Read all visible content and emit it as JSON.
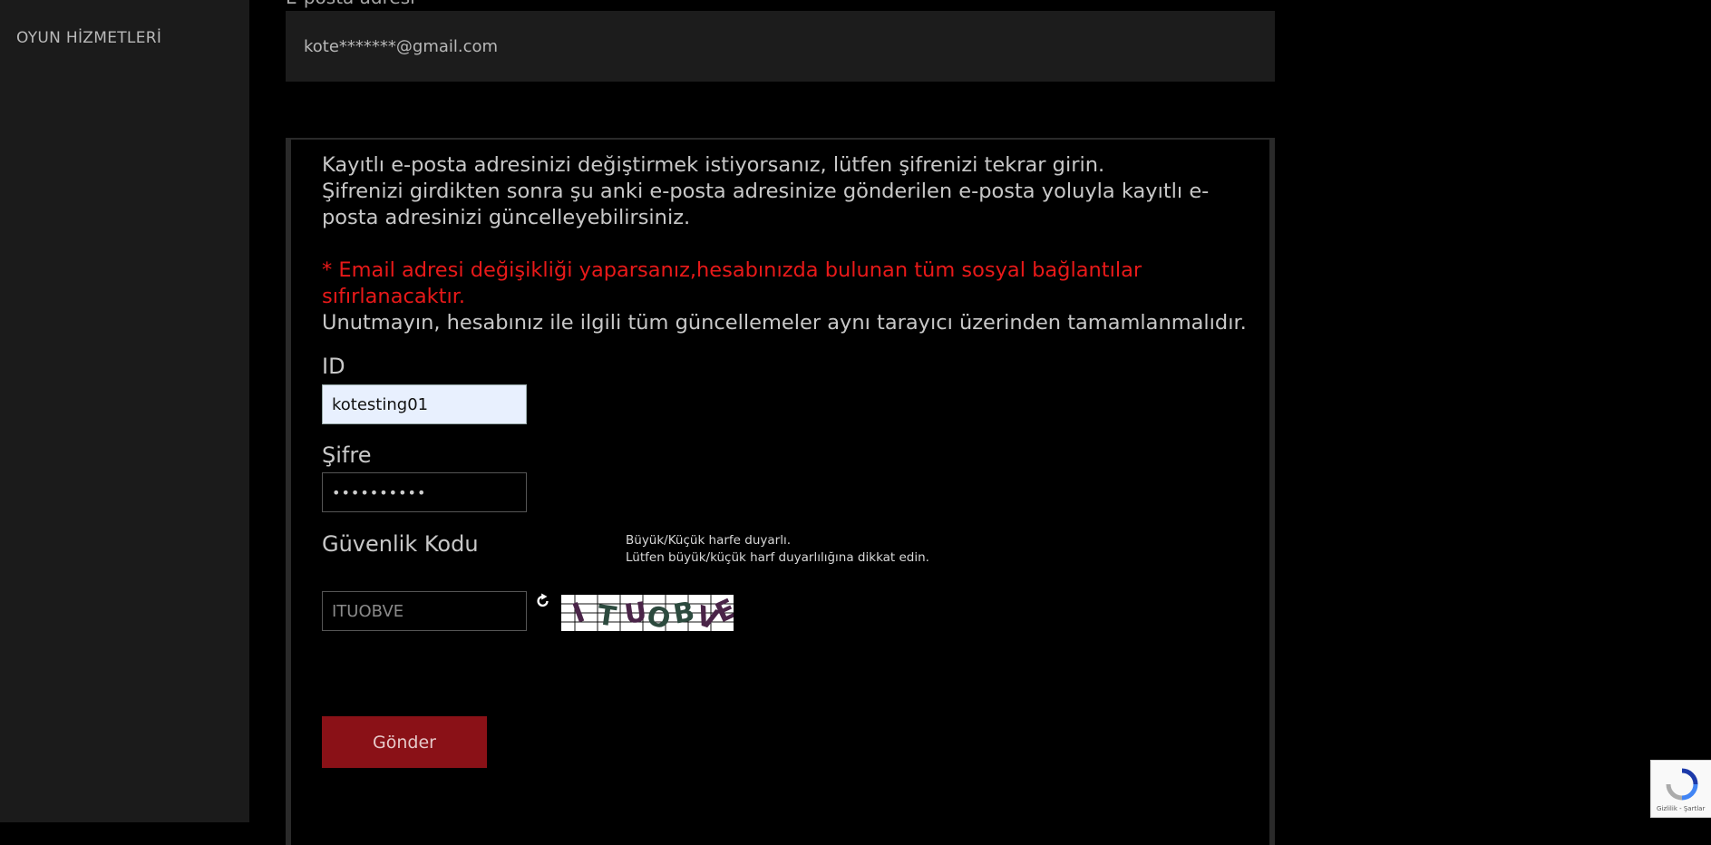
{
  "sidebar": {
    "items": [
      {
        "label": "OYUN HİZMETLERİ"
      }
    ]
  },
  "email": {
    "label": "E-posta adresi",
    "value": "kote*******@gmail.com"
  },
  "notice": {
    "line1": "Kayıtlı e-posta adresinizi değiştirmek istiyorsanız, lütfen şifrenizi tekrar girin.",
    "line2": "Şifrenizi girdikten sonra şu anki e-posta adresinize gönderilen e-posta yoluyla kayıtlı e-posta adresinizi güncelleyebilirsiniz.",
    "warning": "* Email adresi değişikliği yaparsanız,hesabınızda bulunan tüm sosyal bağlantılar sıfırlanacaktır.",
    "line3": "Unutmayın, hesabınız ile ilgili tüm güncellemeler aynı tarayıcı üzerinden tamamlanmalıdır."
  },
  "form": {
    "id_label": "ID",
    "id_value": "kotesting01",
    "password_label": "Şifre",
    "password_value": "••••••••••",
    "security_label": "Güvenlik Kodu",
    "hint_line1": "Büyük/Küçük harfe duyarlı.",
    "hint_line2": "Lütfen büyük/küçük harf duyarlılığına dikkat edin.",
    "captcha_input_value": "ITUOBVE",
    "captcha_letters": [
      "I",
      "T",
      "U",
      "O",
      "B",
      "V",
      "E"
    ],
    "submit_label": "Gönder"
  },
  "recaptcha": {
    "text": "Gizlilik - Şartlar"
  },
  "colors": {
    "accent": "#8a1117",
    "warning": "#e81919",
    "sidebar": "#1b1b1b"
  }
}
